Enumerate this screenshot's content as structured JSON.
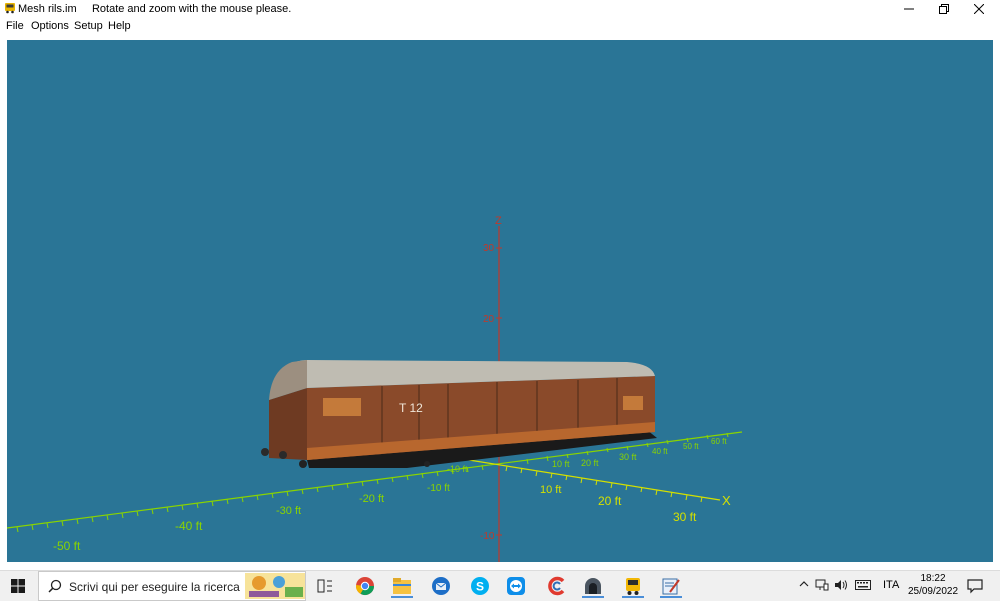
{
  "window": {
    "title": "Mesh rils.im",
    "hint": "Rotate and zoom with the mouse please.",
    "app_icon": "bus-icon",
    "controls": [
      "minimize-icon",
      "restore-icon",
      "close-icon"
    ]
  },
  "menu": {
    "items": [
      "File",
      "Options",
      "Setup",
      "Help"
    ]
  },
  "viewport": {
    "background": "#2a7596",
    "z_axis": {
      "label": "Z",
      "color": "#c0392b",
      "ticks": [
        "30",
        "20",
        "-10"
      ]
    },
    "x_axis": {
      "label": "X",
      "color": "#d4e000",
      "ticks": [
        "10 ft",
        "20 ft",
        "30 ft"
      ]
    },
    "y_axis": {
      "color": "#8ad400",
      "ticks": [
        "-50 ft",
        "-40 ft",
        "-30 ft",
        "-20 ft",
        "-10 ft",
        "-10 ft"
      ]
    },
    "ground_grid_ticks": [
      "10 ft",
      "20 ft",
      "30 ft",
      "40 ft",
      "50 ft",
      "60 ft"
    ],
    "model": {
      "name": "freight wagon",
      "marking": "T 12",
      "body_color": "#8a4a2a",
      "roof_color": "#bfbcb2"
    }
  },
  "taskbar": {
    "search_placeholder": "Scrivi qui per eseguire la ricerca",
    "apps": [
      "task-view-icon",
      "chrome-icon",
      "file-explorer-icon",
      "thunderbird-icon",
      "skype-icon",
      "teamviewer-icon",
      "ccleaner-icon",
      "tunnel-app-icon",
      "bus-app-icon",
      "editor-app-icon"
    ],
    "tray": {
      "language": "ITA",
      "time": "18:22",
      "date": "25/09/2022"
    }
  }
}
